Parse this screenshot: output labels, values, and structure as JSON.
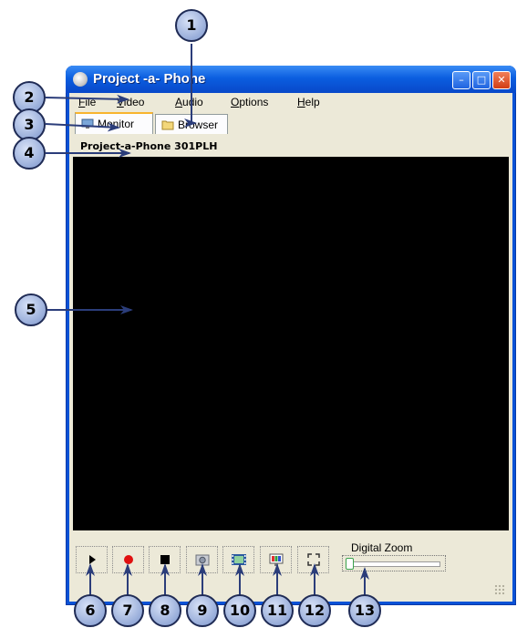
{
  "window": {
    "title": "Project -a- Phone",
    "buttons": {
      "minimize": "–",
      "maximize": "□",
      "close": "✕"
    }
  },
  "menu": {
    "items": [
      {
        "label": "File",
        "accel": "F",
        "rest": "ile"
      },
      {
        "label": "Video",
        "accel": "V",
        "rest": "ideo"
      },
      {
        "label": "Audio",
        "accel": "A",
        "rest": "udio"
      },
      {
        "label": "Options",
        "accel": "O",
        "rest": "ptions"
      },
      {
        "label": "Help",
        "accel": "H",
        "rest": "elp"
      }
    ]
  },
  "tabs": [
    {
      "label": "Monitor",
      "active": true,
      "icon": "monitor-icon"
    },
    {
      "label": "Browser",
      "active": false,
      "icon": "folder-icon"
    }
  ],
  "device": {
    "name": "Project-a-Phone 301PLH"
  },
  "controls": {
    "buttons": [
      {
        "name": "play-button",
        "icon": "play-icon"
      },
      {
        "name": "record-button",
        "icon": "record-icon"
      },
      {
        "name": "stop-button",
        "icon": "stop-icon"
      },
      {
        "name": "snapshot-button",
        "icon": "camera-icon"
      },
      {
        "name": "video-clip-button",
        "icon": "film-icon"
      },
      {
        "name": "image-settings-button",
        "icon": "palette-icon"
      },
      {
        "name": "fullscreen-button",
        "icon": "fullscreen-icon"
      }
    ],
    "zoom": {
      "label": "Digital Zoom",
      "level": 0
    }
  },
  "callouts": [
    "1",
    "2",
    "3",
    "4",
    "5",
    "6",
    "7",
    "8",
    "9",
    "10",
    "11",
    "12",
    "13"
  ],
  "colors": {
    "accent": "#0a52d6",
    "callout_border": "#1f2b55",
    "record": "#e01010"
  }
}
